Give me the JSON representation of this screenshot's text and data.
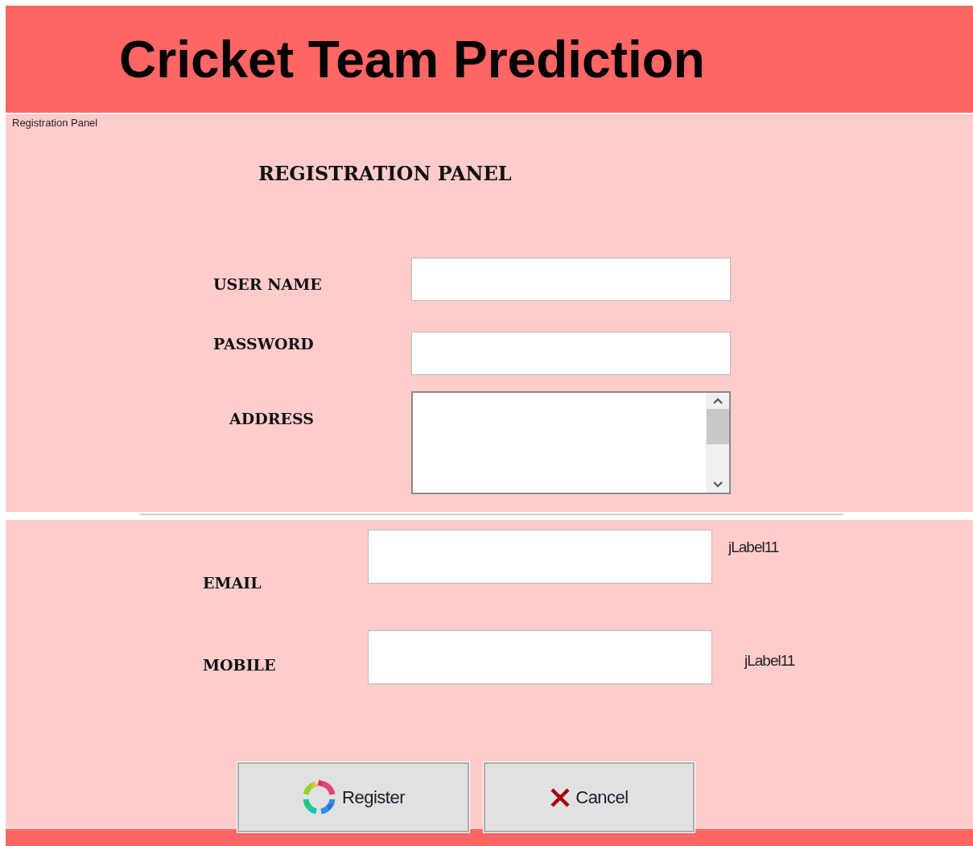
{
  "header": {
    "title": "Cricket Team Prediction"
  },
  "registration_panel": {
    "border_title": "Registration Panel",
    "heading": "REGISTRATION PANEL",
    "fields": [
      {
        "label": "USER NAME",
        "kind": "text"
      },
      {
        "label": "PASSWORD",
        "kind": "password"
      },
      {
        "label": "ADDRESS",
        "kind": "textarea"
      }
    ]
  },
  "contact_panel": {
    "fields": [
      {
        "label": "EMAIL",
        "note": "jLabel11"
      },
      {
        "label": "MOBILE",
        "note": "jLabel11"
      }
    ]
  },
  "buttons": [
    {
      "label": "Register",
      "kind": "register"
    },
    {
      "label": "Cancel",
      "kind": "cancel"
    }
  ]
}
